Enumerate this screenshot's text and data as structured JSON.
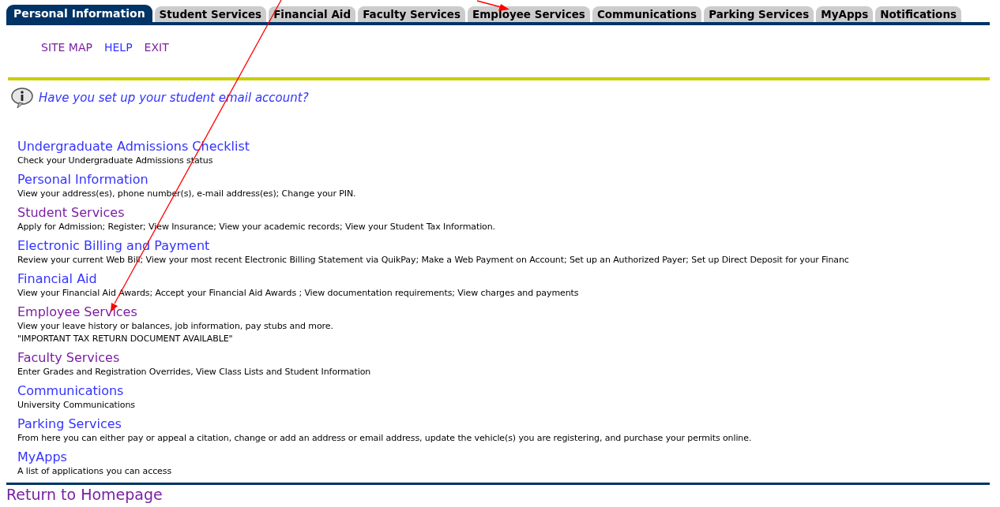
{
  "tabs": [
    {
      "label": "Personal Information",
      "selected": true
    },
    {
      "label": "Student Services",
      "selected": false
    },
    {
      "label": "Financial Aid",
      "selected": false
    },
    {
      "label": "Faculty Services",
      "selected": false
    },
    {
      "label": "Employee Services",
      "selected": false
    },
    {
      "label": "Communications",
      "selected": false
    },
    {
      "label": "Parking Services",
      "selected": false
    },
    {
      "label": "MyApps",
      "selected": false
    },
    {
      "label": "Notifications",
      "selected": false
    }
  ],
  "top_links": [
    {
      "label": "SITE MAP",
      "visited": true
    },
    {
      "label": "HELP",
      "visited": false
    },
    {
      "label": "EXIT",
      "visited": true
    }
  ],
  "info_message": "Have you set up your student email account?",
  "menu": [
    {
      "title": "Undergraduate Admissions Checklist",
      "visited": false,
      "description": [
        "Check your Undergraduate Admissions status"
      ]
    },
    {
      "title": "Personal Information",
      "visited": false,
      "description": [
        "View your address(es), phone number(s), e-mail address(es); Change your PIN."
      ]
    },
    {
      "title": "Student Services",
      "visited": true,
      "description": [
        "Apply for Admission; Register; View Insurance; View your academic records; View your Student Tax Information."
      ]
    },
    {
      "title": "Electronic Billing and Payment",
      "visited": false,
      "description": [
        "Review your current Web Bill; View your most recent Electronic Billing Statement via QuikPay; Make a Web Payment on Account; Set up an Authorized Payer; Set up Direct Deposit for your Financ"
      ]
    },
    {
      "title": "Financial Aid",
      "visited": false,
      "description": [
        "View your Financial Aid Awards; Accept your Financial Aid Awards ; View documentation requirements; View charges and payments"
      ]
    },
    {
      "title": "Employee Services",
      "visited": true,
      "description": [
        "View your leave history or balances, job information, pay stubs and more.",
        "\"IMPORTANT TAX RETURN DOCUMENT AVAILABLE\""
      ]
    },
    {
      "title": "Faculty Services",
      "visited": true,
      "description": [
        "Enter Grades and Registration Overrides, View Class Lists and Student Information"
      ]
    },
    {
      "title": "Communications",
      "visited": false,
      "description": [
        "University Communications"
      ]
    },
    {
      "title": "Parking Services",
      "visited": false,
      "description": [
        "From here you can either pay or appeal a citation, change or add an address or email address, update the vehicle(s) you are registering, and purchase your permits online."
      ]
    },
    {
      "title": "MyApps",
      "visited": false,
      "description": [
        "A list of applications you can access"
      ]
    }
  ],
  "footer_link": {
    "label": "Return to Homepage",
    "visited": true
  }
}
